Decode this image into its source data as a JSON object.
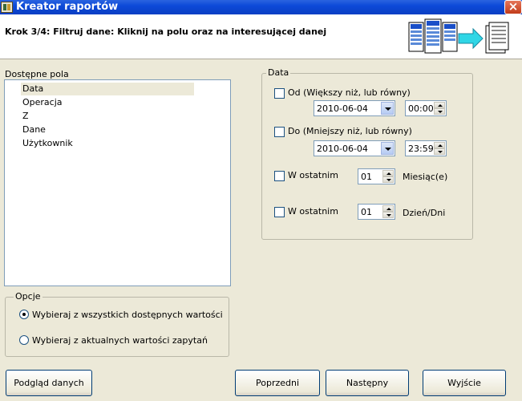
{
  "window": {
    "title": "Kreator raportów",
    "close_label": "×"
  },
  "header": {
    "step": "Krok 3/4: Filtruj dane: Kliknij na polu oraz na interesującej danej"
  },
  "fields": {
    "label": "Dostępne pola",
    "items": [
      "Data",
      "Operacja",
      "Z",
      "Dane",
      "Użytkownik"
    ]
  },
  "date_group": {
    "legend": "Data",
    "from": {
      "label": "Od (Większy niż, lub równy)",
      "date": "2010-06-04",
      "time": "00:00"
    },
    "to": {
      "label": "Do (Mniejszy niż, lub równy)",
      "date": "2010-06-04",
      "time": "23:59"
    },
    "last_months": {
      "label": "W ostatnim",
      "value": "01",
      "unit": "Miesiąc(e)"
    },
    "last_days": {
      "label": "W ostatnim",
      "value": "01",
      "unit": "Dzień/Dni"
    }
  },
  "options": {
    "legend": "Opcje",
    "radio1": "Wybieraj z wszystkich dostępnych wartości",
    "radio2": "Wybieraj z aktualnych wartości zapytań"
  },
  "buttons": {
    "preview": "Podgląd danych",
    "prev": "Poprzedni",
    "next": "Następny",
    "exit": "Wyjście"
  }
}
